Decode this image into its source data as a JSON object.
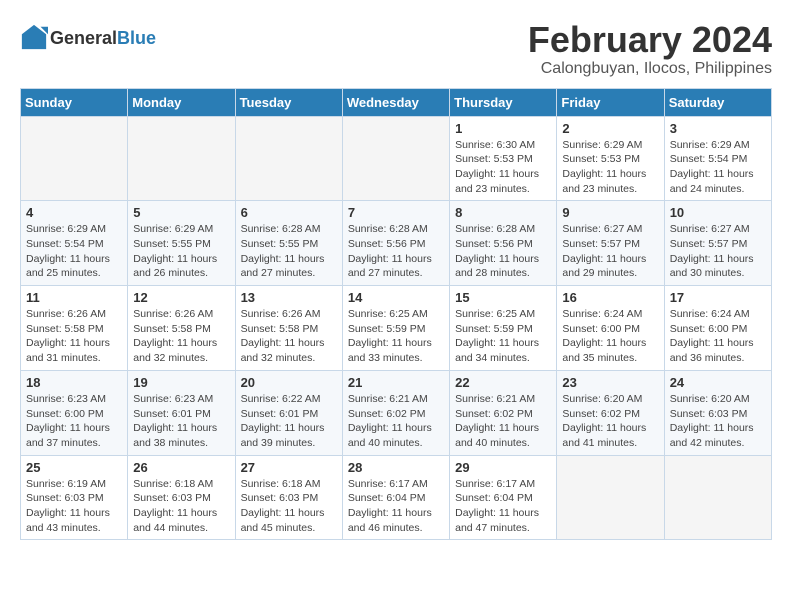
{
  "header": {
    "logo_line1": "General",
    "logo_line2": "Blue",
    "title": "February 2024",
    "subtitle": "Calongbuyan, Ilocos, Philippines"
  },
  "weekdays": [
    "Sunday",
    "Monday",
    "Tuesday",
    "Wednesday",
    "Thursday",
    "Friday",
    "Saturday"
  ],
  "weeks": [
    [
      {
        "day": "",
        "sunrise": "",
        "sunset": "",
        "daylight": ""
      },
      {
        "day": "",
        "sunrise": "",
        "sunset": "",
        "daylight": ""
      },
      {
        "day": "",
        "sunrise": "",
        "sunset": "",
        "daylight": ""
      },
      {
        "day": "",
        "sunrise": "",
        "sunset": "",
        "daylight": ""
      },
      {
        "day": "1",
        "sunrise": "Sunrise: 6:30 AM",
        "sunset": "Sunset: 5:53 PM",
        "daylight": "Daylight: 11 hours and 23 minutes."
      },
      {
        "day": "2",
        "sunrise": "Sunrise: 6:29 AM",
        "sunset": "Sunset: 5:53 PM",
        "daylight": "Daylight: 11 hours and 23 minutes."
      },
      {
        "day": "3",
        "sunrise": "Sunrise: 6:29 AM",
        "sunset": "Sunset: 5:54 PM",
        "daylight": "Daylight: 11 hours and 24 minutes."
      }
    ],
    [
      {
        "day": "4",
        "sunrise": "Sunrise: 6:29 AM",
        "sunset": "Sunset: 5:54 PM",
        "daylight": "Daylight: 11 hours and 25 minutes."
      },
      {
        "day": "5",
        "sunrise": "Sunrise: 6:29 AM",
        "sunset": "Sunset: 5:55 PM",
        "daylight": "Daylight: 11 hours and 26 minutes."
      },
      {
        "day": "6",
        "sunrise": "Sunrise: 6:28 AM",
        "sunset": "Sunset: 5:55 PM",
        "daylight": "Daylight: 11 hours and 27 minutes."
      },
      {
        "day": "7",
        "sunrise": "Sunrise: 6:28 AM",
        "sunset": "Sunset: 5:56 PM",
        "daylight": "Daylight: 11 hours and 27 minutes."
      },
      {
        "day": "8",
        "sunrise": "Sunrise: 6:28 AM",
        "sunset": "Sunset: 5:56 PM",
        "daylight": "Daylight: 11 hours and 28 minutes."
      },
      {
        "day": "9",
        "sunrise": "Sunrise: 6:27 AM",
        "sunset": "Sunset: 5:57 PM",
        "daylight": "Daylight: 11 hours and 29 minutes."
      },
      {
        "day": "10",
        "sunrise": "Sunrise: 6:27 AM",
        "sunset": "Sunset: 5:57 PM",
        "daylight": "Daylight: 11 hours and 30 minutes."
      }
    ],
    [
      {
        "day": "11",
        "sunrise": "Sunrise: 6:26 AM",
        "sunset": "Sunset: 5:58 PM",
        "daylight": "Daylight: 11 hours and 31 minutes."
      },
      {
        "day": "12",
        "sunrise": "Sunrise: 6:26 AM",
        "sunset": "Sunset: 5:58 PM",
        "daylight": "Daylight: 11 hours and 32 minutes."
      },
      {
        "day": "13",
        "sunrise": "Sunrise: 6:26 AM",
        "sunset": "Sunset: 5:58 PM",
        "daylight": "Daylight: 11 hours and 32 minutes."
      },
      {
        "day": "14",
        "sunrise": "Sunrise: 6:25 AM",
        "sunset": "Sunset: 5:59 PM",
        "daylight": "Daylight: 11 hours and 33 minutes."
      },
      {
        "day": "15",
        "sunrise": "Sunrise: 6:25 AM",
        "sunset": "Sunset: 5:59 PM",
        "daylight": "Daylight: 11 hours and 34 minutes."
      },
      {
        "day": "16",
        "sunrise": "Sunrise: 6:24 AM",
        "sunset": "Sunset: 6:00 PM",
        "daylight": "Daylight: 11 hours and 35 minutes."
      },
      {
        "day": "17",
        "sunrise": "Sunrise: 6:24 AM",
        "sunset": "Sunset: 6:00 PM",
        "daylight": "Daylight: 11 hours and 36 minutes."
      }
    ],
    [
      {
        "day": "18",
        "sunrise": "Sunrise: 6:23 AM",
        "sunset": "Sunset: 6:00 PM",
        "daylight": "Daylight: 11 hours and 37 minutes."
      },
      {
        "day": "19",
        "sunrise": "Sunrise: 6:23 AM",
        "sunset": "Sunset: 6:01 PM",
        "daylight": "Daylight: 11 hours and 38 minutes."
      },
      {
        "day": "20",
        "sunrise": "Sunrise: 6:22 AM",
        "sunset": "Sunset: 6:01 PM",
        "daylight": "Daylight: 11 hours and 39 minutes."
      },
      {
        "day": "21",
        "sunrise": "Sunrise: 6:21 AM",
        "sunset": "Sunset: 6:02 PM",
        "daylight": "Daylight: 11 hours and 40 minutes."
      },
      {
        "day": "22",
        "sunrise": "Sunrise: 6:21 AM",
        "sunset": "Sunset: 6:02 PM",
        "daylight": "Daylight: 11 hours and 40 minutes."
      },
      {
        "day": "23",
        "sunrise": "Sunrise: 6:20 AM",
        "sunset": "Sunset: 6:02 PM",
        "daylight": "Daylight: 11 hours and 41 minutes."
      },
      {
        "day": "24",
        "sunrise": "Sunrise: 6:20 AM",
        "sunset": "Sunset: 6:03 PM",
        "daylight": "Daylight: 11 hours and 42 minutes."
      }
    ],
    [
      {
        "day": "25",
        "sunrise": "Sunrise: 6:19 AM",
        "sunset": "Sunset: 6:03 PM",
        "daylight": "Daylight: 11 hours and 43 minutes."
      },
      {
        "day": "26",
        "sunrise": "Sunrise: 6:18 AM",
        "sunset": "Sunset: 6:03 PM",
        "daylight": "Daylight: 11 hours and 44 minutes."
      },
      {
        "day": "27",
        "sunrise": "Sunrise: 6:18 AM",
        "sunset": "Sunset: 6:03 PM",
        "daylight": "Daylight: 11 hours and 45 minutes."
      },
      {
        "day": "28",
        "sunrise": "Sunrise: 6:17 AM",
        "sunset": "Sunset: 6:04 PM",
        "daylight": "Daylight: 11 hours and 46 minutes."
      },
      {
        "day": "29",
        "sunrise": "Sunrise: 6:17 AM",
        "sunset": "Sunset: 6:04 PM",
        "daylight": "Daylight: 11 hours and 47 minutes."
      },
      {
        "day": "",
        "sunrise": "",
        "sunset": "",
        "daylight": ""
      },
      {
        "day": "",
        "sunrise": "",
        "sunset": "",
        "daylight": ""
      }
    ]
  ]
}
